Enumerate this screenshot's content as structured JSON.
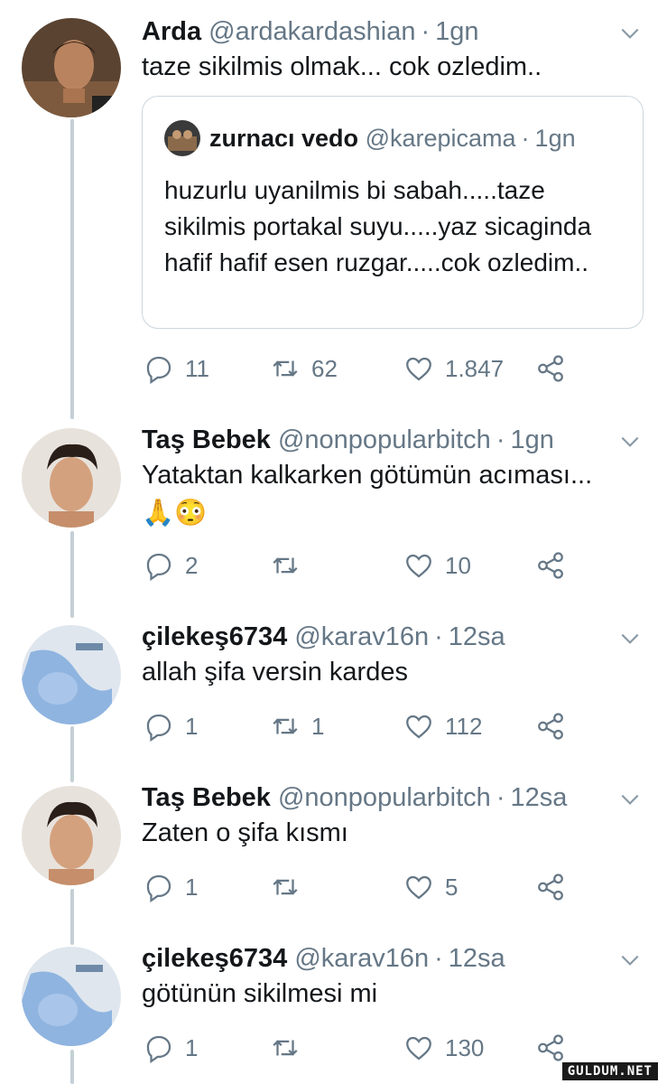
{
  "tweets": [
    {
      "name": "Arda",
      "handle": "@ardakardashian",
      "time": "1gn",
      "text": "taze sikilmis olmak... cok ozledim..",
      "avatar_icon": "person-photo",
      "quote": {
        "name": "zurnacı vedo",
        "handle": "@karepicama",
        "time": "1gn",
        "text": "huzurlu uyanilmis bi sabah.....taze sikilmis portakal suyu.....yaz sicaginda hafif hafif esen ruzgar.....cok ozledim.."
      },
      "replies": "11",
      "retweets": "62",
      "likes": "1.847"
    },
    {
      "name": "Taş Bebek",
      "handle": "@nonpopularbitch",
      "time": "1gn",
      "text": "Yataktan kalkarken götümün acıması...",
      "emoji": "🙏😳",
      "replies": "2",
      "retweets": "",
      "likes": "10"
    },
    {
      "name": "çilekeş6734",
      "handle": "@karav16n",
      "time": "12sa",
      "text": "allah şifa versin kardes",
      "replies": "1",
      "retweets": "1",
      "likes": "112"
    },
    {
      "name": "Taş Bebek",
      "handle": "@nonpopularbitch",
      "time": "12sa",
      "text": "Zaten o şifa kısmı",
      "replies": "1",
      "retweets": "",
      "likes": "5"
    },
    {
      "name": "çilekeş6734",
      "handle": "@karav16n",
      "time": "12sa",
      "text": "götünün sikilmesi mi",
      "replies": "1",
      "retweets": "",
      "likes": "130"
    }
  ],
  "separator": "·",
  "watermark": "GULDUM.NET",
  "colors": {
    "text": "#14171a",
    "muted": "#657786",
    "line": "#c4cfd6",
    "border": "#ccd6dd"
  }
}
